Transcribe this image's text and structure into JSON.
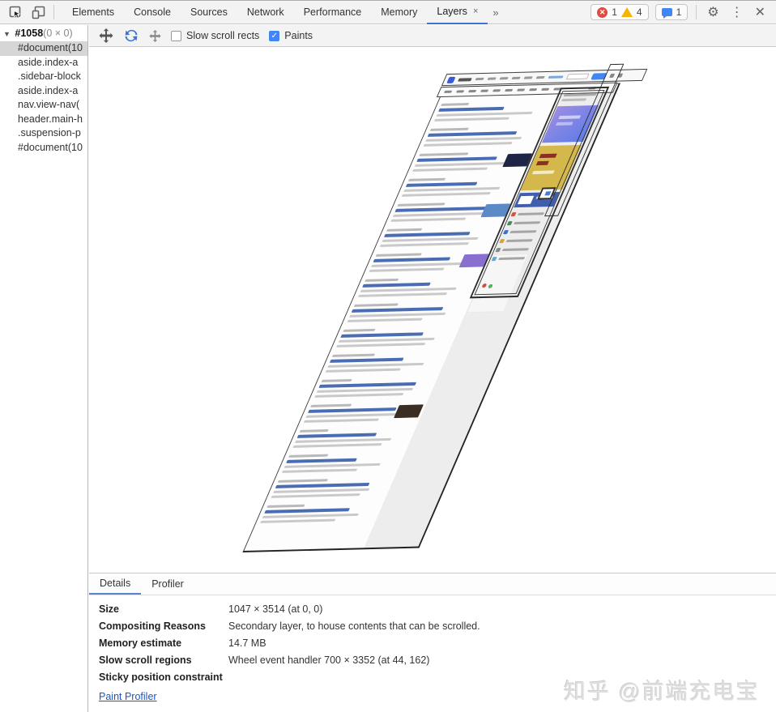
{
  "window": {
    "tabs": [
      "Elements",
      "Console",
      "Sources",
      "Network",
      "Performance",
      "Memory",
      "Layers"
    ],
    "active_tab": "Layers",
    "badges": {
      "error_count": "1",
      "warning_count": "4",
      "message_count": "1"
    }
  },
  "icons": {
    "tree_expander": "▼",
    "tab_close": "×",
    "more_tabs": "»",
    "gear": "⚙",
    "overflow_dots": "⋮",
    "close": "✕",
    "checkmark": "✓"
  },
  "toolbar": {
    "slow_scroll_label": "Slow scroll rects",
    "slow_scroll_checked": false,
    "paints_label": "Paints",
    "paints_checked": true
  },
  "layer_tree": {
    "root_name": "#1058",
    "root_size": "(0 × 0)",
    "selected_index": 0,
    "items": [
      "#document(10",
      "aside.index-a",
      ".sidebar-block",
      "aside.index-a",
      "nav.view-nav(",
      "header.main-h",
      ".suspension-p",
      "#document(10"
    ]
  },
  "details_pane": {
    "tabs": [
      "Details",
      "Profiler"
    ],
    "active_tab": "Details",
    "rows": [
      {
        "label": "Size",
        "value": "1047 × 3514 (at 0, 0)"
      },
      {
        "label": "Compositing Reasons",
        "value": "Secondary layer, to house contents that can be scrolled."
      },
      {
        "label": "Memory estimate",
        "value": "14.7 MB"
      },
      {
        "label": "Slow scroll regions",
        "value": "Wheel event handler 700 × 3352 (at 44, 162)"
      },
      {
        "label": "Sticky position constraint",
        "value": ""
      }
    ],
    "link_label": "Paint Profiler"
  },
  "watermark": "知乎 @前端充电宝",
  "colors": {
    "accent_blue": "#4285f4",
    "tab_underline": "#3f73d3",
    "details_underline": "#5b85c7",
    "link_blue": "#1a56c4",
    "error_red": "#e04a3f",
    "warning_yellow": "#f4b400",
    "entry_title_blue": "#4a6cb3",
    "entry_meta_gray": "#b9b9b9",
    "entry_body_gray": "#c9c9c9"
  },
  "scene": {
    "entry_count": 17,
    "entry_thumbs": {
      "2": "#1e2546",
      "4": "#5b8ac6",
      "6": "#8a6fd0",
      "12": "#3a2d24"
    },
    "ads": {
      "purple_start": "#9c8de2",
      "purple_end": "#5f7ce8",
      "gold_bg": "#d5b84c",
      "gold_text": "#8a2f22",
      "blue_card": "#3f5fae",
      "link_icon_colors": [
        "#d0543f",
        "#3f8f5a",
        "#3f6fd0",
        "#e0a030",
        "#888888",
        "#60a8d8"
      ],
      "dot_red": "#d05040",
      "dot_green": "#58b060"
    }
  }
}
